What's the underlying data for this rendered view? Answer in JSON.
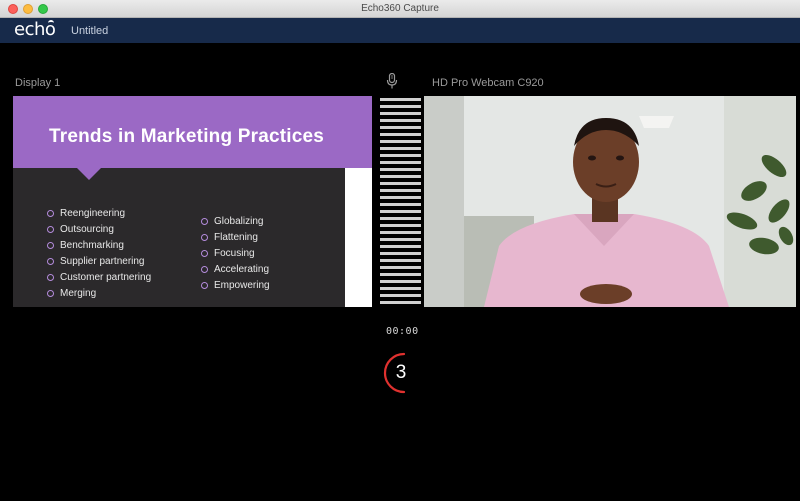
{
  "window": {
    "title": "Echo360 Capture"
  },
  "app": {
    "logo_text": "echo",
    "document_title": "Untitled"
  },
  "sources": {
    "display_label": "Display 1",
    "camera_label": "HD Pro Webcam C920"
  },
  "slide": {
    "title": "Trends in Marketing Practices",
    "bullets_left": [
      "Reengineering",
      "Outsourcing",
      "Benchmarking",
      "Supplier partnering",
      "Customer partnering",
      "Merging"
    ],
    "bullets_right": [
      "Globalizing",
      "Flattening",
      "Focusing",
      "Accelerating",
      "Empowering"
    ]
  },
  "recording": {
    "timer": "00:00",
    "countdown": "3"
  },
  "colors": {
    "appbar": "#172a4a",
    "slide_header": "#9b69c5",
    "countdown_ring": "#e0312f"
  },
  "icons": [
    "microphone-icon"
  ]
}
